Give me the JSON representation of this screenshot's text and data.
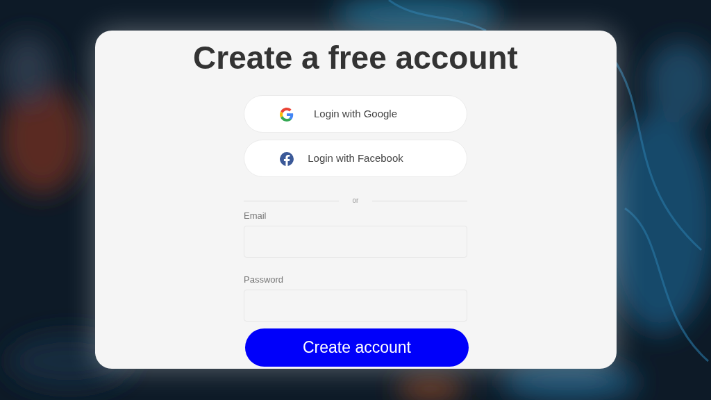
{
  "title": "Create a free account",
  "social_buttons": [
    {
      "kind": "google",
      "label": "Login with Google"
    },
    {
      "kind": "facebook",
      "label": "Login with Facebook"
    }
  ],
  "divider": "or",
  "fields": [
    {
      "label": "Email"
    },
    {
      "label": "Password"
    }
  ],
  "submit": "Create account"
}
